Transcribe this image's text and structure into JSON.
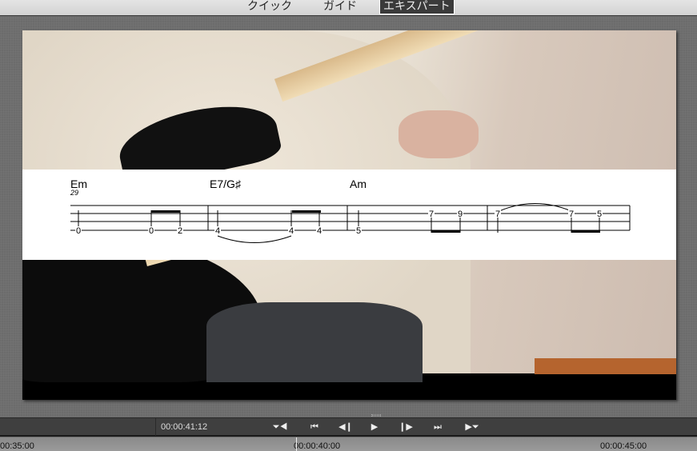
{
  "modes": [
    {
      "label": "クイック",
      "active": false
    },
    {
      "label": "ガイド",
      "active": false
    },
    {
      "label": "エキスパート",
      "active": true
    }
  ],
  "tab": {
    "chords": [
      {
        "label": "Em",
        "sub": "29"
      },
      {
        "label": "E7/G♯"
      },
      {
        "label": "Am"
      }
    ],
    "notes": [
      {
        "fret": "0",
        "string": 4
      },
      {
        "fret": "0",
        "string": 4
      },
      {
        "fret": "2",
        "string": 4
      },
      {
        "fret": "4",
        "string": 4
      },
      {
        "fret": "4",
        "string": 4
      },
      {
        "fret": "4",
        "string": 4
      },
      {
        "fret": "5",
        "string": 4
      },
      {
        "fret": "7",
        "string": 2
      },
      {
        "fret": "9",
        "string": 2
      },
      {
        "fret": "7",
        "string": 2
      },
      {
        "fret": "7",
        "string": 2
      },
      {
        "fret": "5",
        "string": 2
      }
    ]
  },
  "controls": {
    "timecode": "00:00:41:12",
    "buttons": [
      {
        "icon": "mark-in-icon",
        "glyph": "⏷◀"
      },
      {
        "icon": "skip-back-icon",
        "glyph": "⏮"
      },
      {
        "icon": "step-back-icon",
        "glyph": "◀❙"
      },
      {
        "icon": "play-icon",
        "glyph": "▶"
      },
      {
        "icon": "step-forward-icon",
        "glyph": "❙▶"
      },
      {
        "icon": "skip-forward-icon",
        "glyph": "⏭"
      },
      {
        "icon": "mark-out-icon",
        "glyph": "▶⏷"
      }
    ]
  },
  "ruler": {
    "labels": [
      "00:35:00",
      "00:00:40:00",
      "00:00:45:00"
    ]
  }
}
